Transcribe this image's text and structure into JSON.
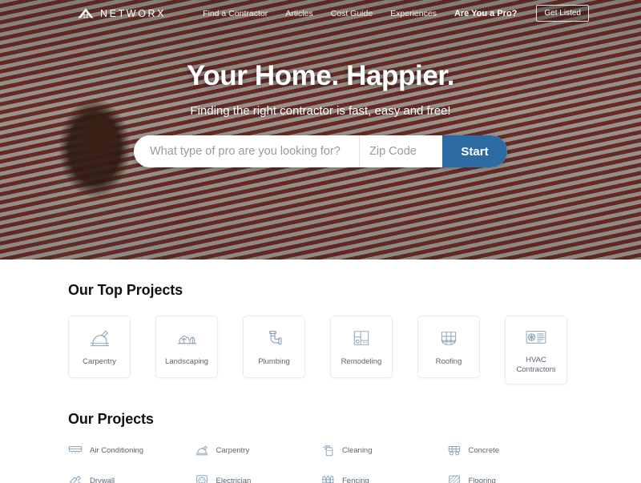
{
  "brand": {
    "logo_text": "NETWORX",
    "logo_icon": "house-roof-icon"
  },
  "nav": {
    "links": [
      {
        "label": "Find a Contractor"
      },
      {
        "label": "Articles"
      },
      {
        "label": "Cost Guide"
      },
      {
        "label": "Experiences"
      },
      {
        "label": "Are You a Pro?"
      }
    ],
    "cta_label": "Get Listed"
  },
  "hero": {
    "title": "Your Home. Happier.",
    "subtitle": "Finding the right contractor is fast, easy and free!",
    "search": {
      "service_placeholder": "What type of pro are you looking for?",
      "service_value": "",
      "zip_placeholder": "Zip Code",
      "zip_value": "",
      "submit_label": "Start",
      "submit_color": "#2c6ca2"
    }
  },
  "top_projects": {
    "title": "Our Top Projects",
    "cards": [
      {
        "label": "Carpentry",
        "icon": "saw-icon"
      },
      {
        "label": "Landscaping",
        "icon": "shrubs-icon"
      },
      {
        "label": "Plumbing",
        "icon": "pipe-icon"
      },
      {
        "label": "Remodeling",
        "icon": "floorplan-icon"
      },
      {
        "label": "Roofing",
        "icon": "shingles-icon"
      },
      {
        "label": "HVAC Contractors",
        "icon": "hvac-panel-icon"
      }
    ]
  },
  "our_projects": {
    "title": "Our Projects",
    "items": [
      {
        "label": "Air Conditioning",
        "icon": "ac-unit-icon"
      },
      {
        "label": "Carpentry",
        "icon": "saw-icon"
      },
      {
        "label": "Cleaning",
        "icon": "spray-bottle-icon"
      },
      {
        "label": "Concrete",
        "icon": "cement-mixer-icon"
      },
      {
        "label": "Drywall",
        "icon": "drywall-icon"
      },
      {
        "label": "Electrician",
        "icon": "outlet-icon"
      },
      {
        "label": "Fencing",
        "icon": "fence-icon"
      },
      {
        "label": "Flooring",
        "icon": "flooring-icon"
      }
    ]
  },
  "colors": {
    "accent_blue": "#2c6ca2",
    "icon_blue_gray": "#8aa2b8",
    "text_muted": "#5a6470",
    "card_border": "#e9ecef"
  }
}
